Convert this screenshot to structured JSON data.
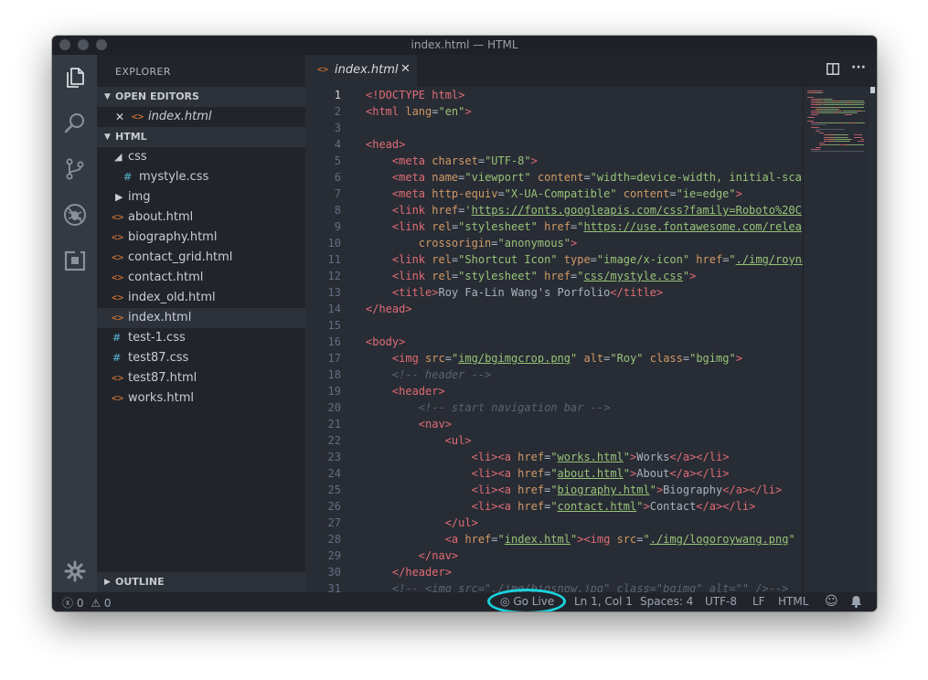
{
  "window": {
    "title": "index.html — HTML"
  },
  "activity_bar": {
    "icons": [
      "files-icon",
      "search-icon",
      "source-control-icon",
      "debug-icon",
      "extensions-icon",
      "gear-icon"
    ]
  },
  "sidebar": {
    "title": "EXPLORER",
    "open_editors": {
      "header": "OPEN EDITORS",
      "items": [
        {
          "label": "index.html",
          "icon": "html-file-icon"
        }
      ]
    },
    "folder": {
      "header": "HTML",
      "items": [
        {
          "label": "css",
          "type": "folder-open",
          "depth": 1
        },
        {
          "label": "mystyle.css",
          "type": "css",
          "depth": 2
        },
        {
          "label": "img",
          "type": "folder-closed",
          "depth": 1
        },
        {
          "label": "about.html",
          "type": "html",
          "depth": 1
        },
        {
          "label": "biography.html",
          "type": "html",
          "depth": 1
        },
        {
          "label": "contact_grid.html",
          "type": "html",
          "depth": 1
        },
        {
          "label": "contact.html",
          "type": "html",
          "depth": 1
        },
        {
          "label": "index_old.html",
          "type": "html",
          "depth": 1
        },
        {
          "label": "index.html",
          "type": "html",
          "depth": 1,
          "selected": true
        },
        {
          "label": "test-1.css",
          "type": "css",
          "depth": 1
        },
        {
          "label": "test87.css",
          "type": "css",
          "depth": 1
        },
        {
          "label": "test87.html",
          "type": "html",
          "depth": 1
        },
        {
          "label": "works.html",
          "type": "html",
          "depth": 1
        }
      ]
    },
    "outline": {
      "header": "OUTLINE"
    }
  },
  "editor": {
    "tab": {
      "label": "index.html",
      "close": "✕"
    },
    "actions": {
      "split": "split-editor-icon",
      "more": "···"
    },
    "current_line": 1,
    "lines": [
      [
        [
          "tag",
          "<!DOCTYPE html>"
        ]
      ],
      [
        [
          "tag",
          "<html"
        ],
        [
          "attr",
          " lang"
        ],
        [
          "p",
          "="
        ],
        [
          "str",
          "\"en\""
        ],
        [
          "tag",
          ">"
        ]
      ],
      [],
      [
        [
          "tag",
          "<head>"
        ]
      ],
      [
        [
          "txt",
          "    "
        ],
        [
          "tag",
          "<meta"
        ],
        [
          "attr",
          " charset"
        ],
        [
          "p",
          "="
        ],
        [
          "str",
          "\"UTF-8\""
        ],
        [
          "tag",
          ">"
        ]
      ],
      [
        [
          "txt",
          "    "
        ],
        [
          "tag",
          "<meta"
        ],
        [
          "attr",
          " name"
        ],
        [
          "p",
          "="
        ],
        [
          "str",
          "\"viewport\""
        ],
        [
          "attr",
          " content"
        ],
        [
          "p",
          "="
        ],
        [
          "str",
          "\"width=device-width, initial-sca"
        ]
      ],
      [
        [
          "txt",
          "    "
        ],
        [
          "tag",
          "<meta"
        ],
        [
          "attr",
          " http-equiv"
        ],
        [
          "p",
          "="
        ],
        [
          "str",
          "\"X-UA-Compatible\""
        ],
        [
          "attr",
          " content"
        ],
        [
          "p",
          "="
        ],
        [
          "str",
          "\"ie=edge\""
        ],
        [
          "tag",
          ">"
        ]
      ],
      [
        [
          "txt",
          "    "
        ],
        [
          "tag",
          "<link"
        ],
        [
          "attr",
          " href"
        ],
        [
          "p",
          "="
        ],
        [
          "str",
          "'"
        ],
        [
          "link",
          "https://fonts.googleapis.com/css?family=Roboto%20C"
        ]
      ],
      [
        [
          "txt",
          "    "
        ],
        [
          "tag",
          "<link"
        ],
        [
          "attr",
          " rel"
        ],
        [
          "p",
          "="
        ],
        [
          "str",
          "\"stylesheet\""
        ],
        [
          "attr",
          " href"
        ],
        [
          "p",
          "="
        ],
        [
          "str",
          "\""
        ],
        [
          "link",
          "https://use.fontawesome.com/relea"
        ]
      ],
      [
        [
          "txt",
          "        "
        ],
        [
          "attr",
          "crossorigin"
        ],
        [
          "p",
          "="
        ],
        [
          "str",
          "\"anonymous\""
        ],
        [
          "tag",
          ">"
        ]
      ],
      [
        [
          "txt",
          "    "
        ],
        [
          "tag",
          "<link"
        ],
        [
          "attr",
          " rel"
        ],
        [
          "p",
          "="
        ],
        [
          "str",
          "\"Shortcut Icon\""
        ],
        [
          "attr",
          " type"
        ],
        [
          "p",
          "="
        ],
        [
          "str",
          "\"image/x-icon\""
        ],
        [
          "attr",
          " href"
        ],
        [
          "p",
          "="
        ],
        [
          "str",
          "\""
        ],
        [
          "link",
          "./img/royna"
        ]
      ],
      [
        [
          "txt",
          "    "
        ],
        [
          "tag",
          "<link"
        ],
        [
          "attr",
          " rel"
        ],
        [
          "p",
          "="
        ],
        [
          "str",
          "\"stylesheet\""
        ],
        [
          "attr",
          " href"
        ],
        [
          "p",
          "="
        ],
        [
          "str",
          "\""
        ],
        [
          "link",
          "css/mystyle.css"
        ],
        [
          "str",
          "\""
        ],
        [
          "tag",
          ">"
        ]
      ],
      [
        [
          "txt",
          "    "
        ],
        [
          "tag",
          "<title>"
        ],
        [
          "txt",
          "Roy Fa-Lin Wang's Porfolio"
        ],
        [
          "tag",
          "</title>"
        ]
      ],
      [
        [
          "tag",
          "</head>"
        ]
      ],
      [],
      [
        [
          "tag",
          "<body>"
        ]
      ],
      [
        [
          "txt",
          "    "
        ],
        [
          "tag",
          "<img"
        ],
        [
          "attr",
          " src"
        ],
        [
          "p",
          "="
        ],
        [
          "str",
          "\""
        ],
        [
          "link",
          "img/bgimgcrop.png"
        ],
        [
          "str",
          "\""
        ],
        [
          "attr",
          " alt"
        ],
        [
          "p",
          "="
        ],
        [
          "str",
          "\"Roy\""
        ],
        [
          "attr",
          " class"
        ],
        [
          "p",
          "="
        ],
        [
          "str",
          "\"bgimg\""
        ],
        [
          "tag",
          ">"
        ]
      ],
      [
        [
          "txt",
          "    "
        ],
        [
          "cm",
          "<!-- header -->"
        ]
      ],
      [
        [
          "txt",
          "    "
        ],
        [
          "tag",
          "<header>"
        ]
      ],
      [
        [
          "txt",
          "        "
        ],
        [
          "cm",
          "<!-- start navigation bar -->"
        ]
      ],
      [
        [
          "txt",
          "        "
        ],
        [
          "tag",
          "<nav>"
        ]
      ],
      [
        [
          "txt",
          "            "
        ],
        [
          "tag",
          "<ul>"
        ]
      ],
      [
        [
          "txt",
          "                "
        ],
        [
          "tag",
          "<li><a"
        ],
        [
          "attr",
          " href"
        ],
        [
          "p",
          "="
        ],
        [
          "str",
          "\""
        ],
        [
          "link",
          "works.html"
        ],
        [
          "str",
          "\""
        ],
        [
          "tag",
          ">"
        ],
        [
          "txt",
          "Works"
        ],
        [
          "tag",
          "</a></li>"
        ]
      ],
      [
        [
          "txt",
          "                "
        ],
        [
          "tag",
          "<li><a"
        ],
        [
          "attr",
          " href"
        ],
        [
          "p",
          "="
        ],
        [
          "str",
          "\""
        ],
        [
          "link",
          "about.html"
        ],
        [
          "str",
          "\""
        ],
        [
          "tag",
          ">"
        ],
        [
          "txt",
          "About"
        ],
        [
          "tag",
          "</a></li>"
        ]
      ],
      [
        [
          "txt",
          "                "
        ],
        [
          "tag",
          "<li><a"
        ],
        [
          "attr",
          " href"
        ],
        [
          "p",
          "="
        ],
        [
          "str",
          "\""
        ],
        [
          "link",
          "biography.html"
        ],
        [
          "str",
          "\""
        ],
        [
          "tag",
          ">"
        ],
        [
          "txt",
          "Biography"
        ],
        [
          "tag",
          "</a></li>"
        ]
      ],
      [
        [
          "txt",
          "                "
        ],
        [
          "tag",
          "<li><a"
        ],
        [
          "attr",
          " href"
        ],
        [
          "p",
          "="
        ],
        [
          "str",
          "\""
        ],
        [
          "link",
          "contact.html"
        ],
        [
          "str",
          "\""
        ],
        [
          "tag",
          ">"
        ],
        [
          "txt",
          "Contact"
        ],
        [
          "tag",
          "</a></li>"
        ]
      ],
      [
        [
          "txt",
          "            "
        ],
        [
          "tag",
          "</ul>"
        ]
      ],
      [
        [
          "txt",
          "            "
        ],
        [
          "tag",
          "<a"
        ],
        [
          "attr",
          " href"
        ],
        [
          "p",
          "="
        ],
        [
          "str",
          "\""
        ],
        [
          "link",
          "index.html"
        ],
        [
          "str",
          "\""
        ],
        [
          "tag",
          "><img"
        ],
        [
          "attr",
          " src"
        ],
        [
          "p",
          "="
        ],
        [
          "str",
          "\""
        ],
        [
          "link",
          "./img/logoroywang.png"
        ],
        [
          "str",
          "\""
        ]
      ],
      [
        [
          "txt",
          "        "
        ],
        [
          "tag",
          "</nav>"
        ]
      ],
      [
        [
          "txt",
          "    "
        ],
        [
          "tag",
          "</header>"
        ]
      ],
      [
        [
          "txt",
          "    "
        ],
        [
          "cm",
          "<!-- <img src=\"./img/bigsnow.jpg\" class=\"bgimg\" alt=\"\" />-->"
        ]
      ]
    ]
  },
  "statusbar": {
    "errors": "0",
    "warnings": "0",
    "go_live": "Go Live",
    "position": "Ln 1, Col 1",
    "spaces": "Spaces: 4",
    "encoding": "UTF-8",
    "eol": "LF",
    "language": "HTML",
    "highlight_color": "#19d3de"
  },
  "colors": {
    "tag": "#e06c75",
    "attr": "#d19a66",
    "string": "#98c379",
    "comment": "#5c6370",
    "html_icon": "#e37933",
    "css_icon": "#519aba"
  }
}
